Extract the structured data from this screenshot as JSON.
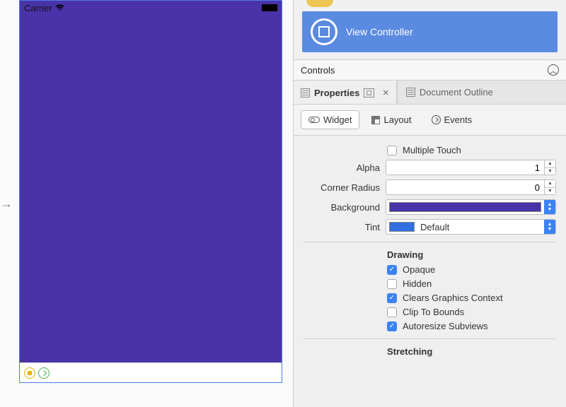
{
  "status_bar": {
    "carrier": "Carrier"
  },
  "hierarchy": {
    "selected_item": "View Controller"
  },
  "toolbox": {
    "section_label": "Controls"
  },
  "pads": {
    "properties_tab": "Properties",
    "outline_tab": "Document Outline"
  },
  "subtabs": {
    "widget": "Widget",
    "layout": "Layout",
    "events": "Events"
  },
  "props": {
    "multiple_touch": {
      "label": "Multiple Touch",
      "checked": false
    },
    "alpha": {
      "label": "Alpha",
      "value": "1"
    },
    "corner_radius": {
      "label": "Corner Radius",
      "value": "0"
    },
    "background": {
      "label": "Background",
      "hex": "#4a33a8"
    },
    "tint": {
      "label": "Tint",
      "text": "Default",
      "hex": "#2f6fe0"
    },
    "drawing": {
      "title": "Drawing",
      "opaque": {
        "label": "Opaque",
        "checked": true
      },
      "hidden": {
        "label": "Hidden",
        "checked": false
      },
      "clears": {
        "label": "Clears Graphics Context",
        "checked": true
      },
      "clip": {
        "label": "Clip To Bounds",
        "checked": false
      },
      "autoresize": {
        "label": "Autoresize Subviews",
        "checked": true
      }
    },
    "stretching": {
      "title": "Stretching"
    }
  }
}
